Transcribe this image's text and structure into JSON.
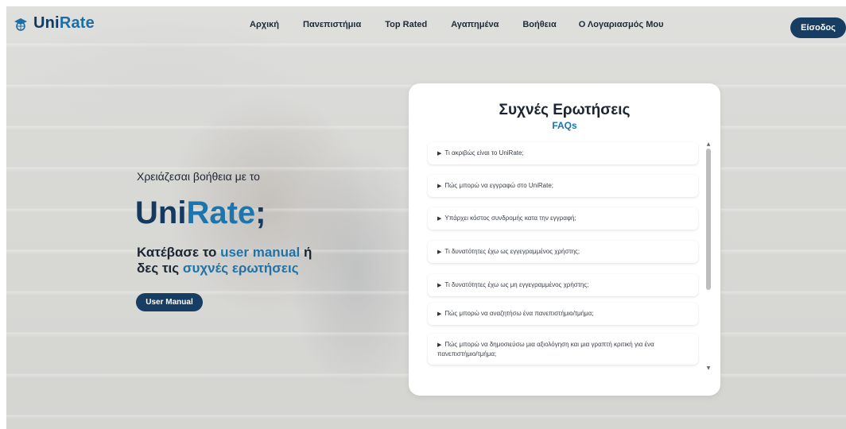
{
  "brand": {
    "name_part1": "Uni",
    "name_part2": "Rate"
  },
  "nav": {
    "items": [
      {
        "label": "Αρχική"
      },
      {
        "label": "Πανεπιστήμια"
      },
      {
        "label": "Top Rated"
      },
      {
        "label": "Αγαπημένα"
      },
      {
        "label": "Βοήθεια"
      },
      {
        "label": "Ο Λογαριασμός Μου"
      }
    ],
    "login_label": "Είσοδος"
  },
  "hero": {
    "subtitle": "Χρειάζεσαι βοήθεια με το",
    "title_part1": "Uni",
    "title_part2": "Rate",
    "title_part3": ";",
    "desc_part1": "Κατέβασε το ",
    "desc_link1": "user manual",
    "desc_part2": " ή δες τις ",
    "desc_link2": "συχνές ερωτήσεις",
    "button_label": "User Manual"
  },
  "faq": {
    "title": "Συχνές Ερωτήσεις",
    "subtitle": "FAQs",
    "marker": "▶",
    "items": [
      {
        "question": "Τι ακριβώς είναι το UniRate;"
      },
      {
        "question": "Πώς μπορώ να εγγραφώ στο UniRate;"
      },
      {
        "question": "Υπάρχει κόστος συνδρομής κατα την εγγραφή;"
      },
      {
        "question": "Τι δυνατότητες έχω ως εγγεγραμμένος χρήστης;"
      },
      {
        "question": "Τι δυνατότητες έχω ως μη εγγεγραμμένος χρήστης;"
      },
      {
        "question": "Πώς μπορώ να αναζητήσω ένα πανεπιστήμιο/τμήμα;"
      },
      {
        "question": "Πώς μπορώ να δημοσιεύσω μια αξιολόγηση και μια γραπτή κριτική για ένα πανεπιστήμιο/τμήμα;"
      }
    ],
    "scroll": {
      "up_icon": "▲",
      "down_icon": "▼"
    }
  }
}
